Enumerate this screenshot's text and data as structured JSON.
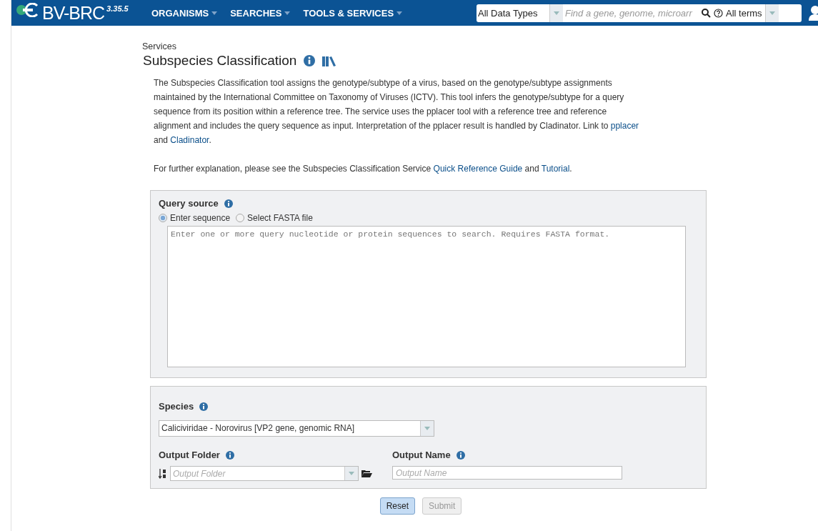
{
  "header": {
    "logo": "BV-BRC",
    "version": "3.35.5",
    "menus": [
      {
        "label": "ORGANISMS"
      },
      {
        "label": "SEARCHES"
      },
      {
        "label": "TOOLS & SERVICES"
      }
    ],
    "search": {
      "data_type": "All Data Types",
      "placeholder": "Find a gene, genome, microarr",
      "terms": "All terms"
    }
  },
  "breadcrumb": "Services",
  "title": "Subspecies Classification",
  "description": [
    [
      {
        "kind": "text",
        "text": "The Subspecies Classification tool assigns the genotype/subtype of a virus, based on the genotype/subtype assignments maintained by the International Committee on Taxonomy of Viruses (ICTV). This tool infers the genotype/subtype for a query sequence from its position within a reference tree. The service uses the pplacer tool with a reference tree and reference alignment and includes the query sequence as input. Interpretation of the pplacer result is handled by Cladinator. Link to "
      },
      {
        "kind": "link",
        "text": "pplacer"
      },
      {
        "kind": "text",
        "text": " and "
      },
      {
        "kind": "link",
        "text": "Cladinator"
      },
      {
        "kind": "text",
        "text": "."
      }
    ],
    [
      {
        "kind": "text",
        "text": "For further explanation, please see the Subspecies Classification Service "
      },
      {
        "kind": "link",
        "text": "Quick Reference Guide"
      },
      {
        "kind": "text",
        "text": " and "
      },
      {
        "kind": "link",
        "text": "Tutorial"
      },
      {
        "kind": "text",
        "text": "."
      }
    ]
  ],
  "query": {
    "label": "Query source",
    "options": [
      {
        "label": "Enter sequence",
        "selected": true
      },
      {
        "label": "Select FASTA file",
        "selected": false
      }
    ],
    "placeholder": "Enter one or more query nucleotide or protein sequences to search. Requires FASTA format."
  },
  "species": {
    "label": "Species",
    "value": "Caliciviridae - Norovirus [VP2 gene, genomic RNA]"
  },
  "output_folder": {
    "label": "Output Folder",
    "placeholder": "Output Folder"
  },
  "output_name": {
    "label": "Output Name",
    "placeholder": "Output Name"
  },
  "buttons": [
    {
      "label": "Reset",
      "disabled": false
    },
    {
      "label": "Submit",
      "disabled": true
    }
  ]
}
